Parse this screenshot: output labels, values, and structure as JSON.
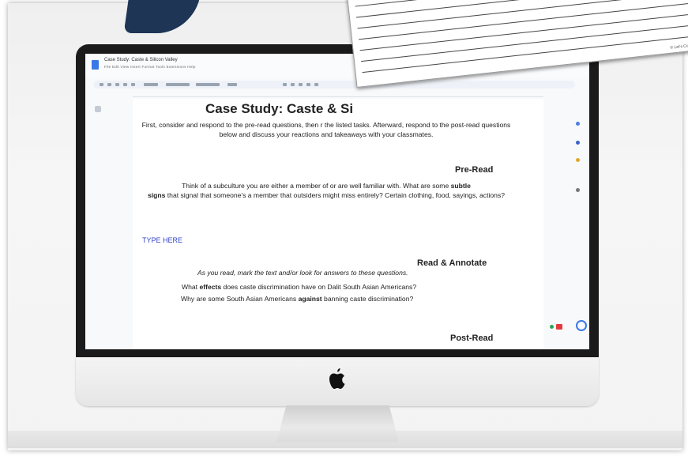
{
  "doc": {
    "title": "Case Study: Caste & Silicon Valley",
    "menu": "File  Edit  View  Insert  Format  Tools  Extensions  Help",
    "heading": "Case Study: Caste & Si",
    "intro": "First, consider and respond to the pre-read questions, then r                                   the listed tasks. Afterward, respond to the post-read questions below and discuss your reactions and takeaways with your classmates.",
    "pre_read_title": "Pre-Read",
    "pre_read_text_1": "Think of a subculture you are either a member of or are well familiar with. What are some ",
    "pre_read_subtle": "subtle",
    "pre_read_text_2": "signs",
    "pre_read_text_3": " that signal that someone's a member that outsiders might miss entirely? Certain clothing, food, sayings, actions?",
    "type_here": "TYPE HERE",
    "read_annotate_title": "Read & Annotate",
    "read_annotate_instruction": "As you read, mark the text and/or look for answers to these questions.",
    "q1_pre": "What ",
    "q1_bold": "effects",
    "q1_post": " does caste discrimination have on Dalit South Asian Americans?",
    "q2_pre": "Why are some South Asian Americans ",
    "q2_bold": "against",
    "q2_post": " banning caste discrimination?",
    "post_read_title": "Post-Read"
  },
  "paper": {
    "copyright": "© Let's Cultivate Greatn"
  },
  "icons": {
    "doc": "google-docs-icon",
    "apple": "apple-logo-icon",
    "gemini": "gemini-icon"
  },
  "colors": {
    "link_blue": "#3343c8",
    "doc_blue": "#3b78e7",
    "corner_navy": "#1e3555"
  }
}
